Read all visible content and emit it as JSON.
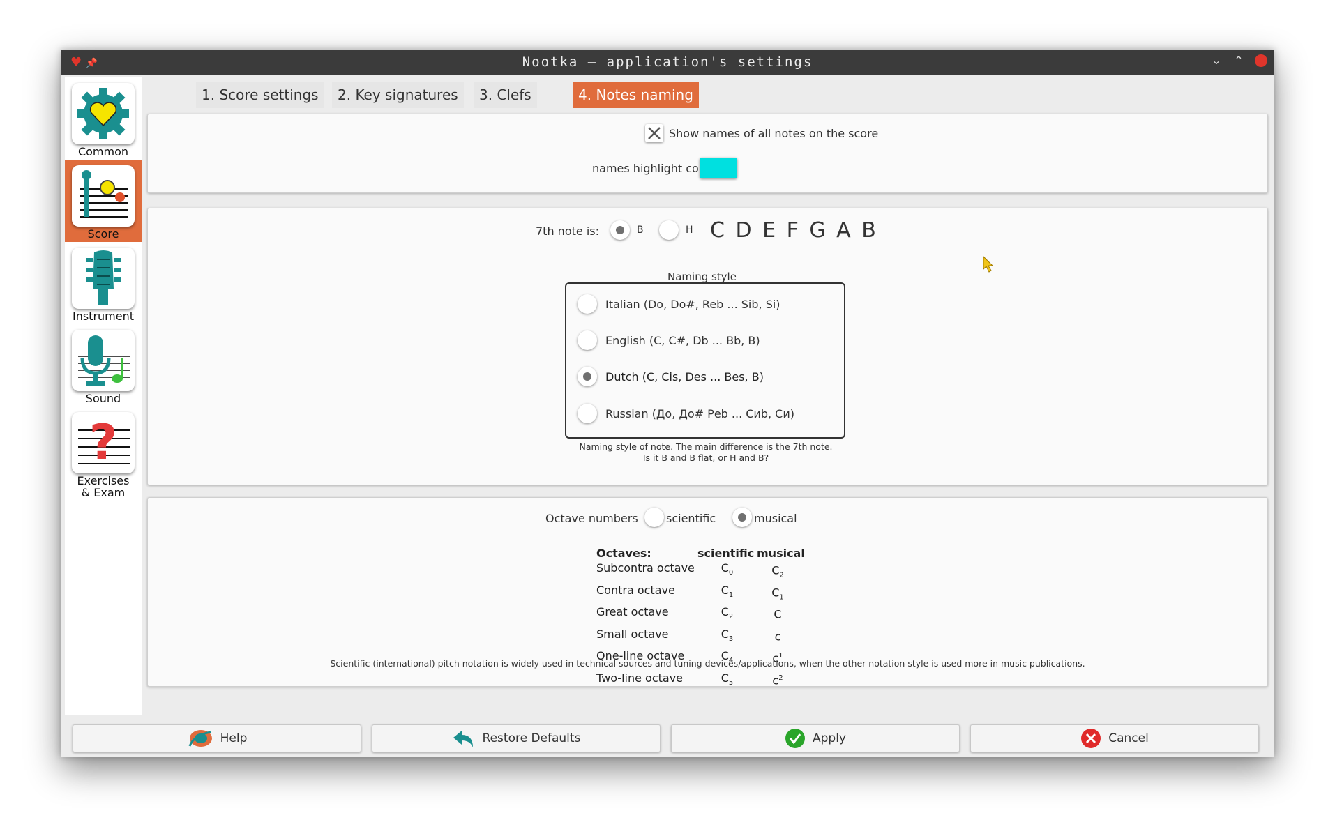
{
  "window": {
    "title": "Nootka – application's settings"
  },
  "sidebar": {
    "items": [
      {
        "label": "Common"
      },
      {
        "label": "Score"
      },
      {
        "label": "Instrument"
      },
      {
        "label": "Sound"
      },
      {
        "label": "Exercises & Exam"
      }
    ]
  },
  "tabs": [
    {
      "label": "1. Score settings"
    },
    {
      "label": "2. Key signatures"
    },
    {
      "label": "3. Clefs"
    },
    {
      "label": "4. Notes naming"
    }
  ],
  "names_panel": {
    "show_names_label": "Show names of all notes on the score",
    "highlight_color_label": "names highlight color",
    "highlight_color": "#00e0e0"
  },
  "naming_panel": {
    "seventh_note_label": "7th note is:",
    "option_b": "B",
    "option_h": "H",
    "scale_preview": "C D E F G A B",
    "naming_style_title": "Naming style",
    "styles": [
      {
        "label": "Italian (Do, Do#, Reb ... Sib, Si)"
      },
      {
        "label": "English (C, C#, Db ... Bb, B)"
      },
      {
        "label": "Dutch (C, Cis, Des ... Bes, B)"
      },
      {
        "label": "Russian (До, До# Реb ... Сиb, Си)"
      }
    ],
    "selected_style": "Dutch (C, Cis, Des ... Bes, B)",
    "description_line1": "Naming style of note. The main difference is the 7th note.",
    "description_line2": "Is it B and B flat, or H and B?"
  },
  "octave_panel": {
    "label": "Octave numbers",
    "option_scientific": "scientific",
    "option_musical": "musical",
    "table_headers": [
      "Octaves:",
      "scientific",
      "musical"
    ],
    "rows": [
      {
        "name": "Subcontra octave",
        "sci": "C",
        "sci_sub": "0",
        "mus": "C",
        "mus_sub": "2",
        "mus_sup": ""
      },
      {
        "name": "Contra octave",
        "sci": "C",
        "sci_sub": "1",
        "mus": "C",
        "mus_sub": "1",
        "mus_sup": ""
      },
      {
        "name": "Great octave",
        "sci": "C",
        "sci_sub": "2",
        "mus": "C",
        "mus_sub": "",
        "mus_sup": ""
      },
      {
        "name": "Small octave",
        "sci": "C",
        "sci_sub": "3",
        "mus": "c",
        "mus_sub": "",
        "mus_sup": ""
      },
      {
        "name": "One-line octave",
        "sci": "C",
        "sci_sub": "4",
        "mus": "c",
        "mus_sub": "",
        "mus_sup": "1"
      },
      {
        "name": "Two-line octave",
        "sci": "C",
        "sci_sub": "5",
        "mus": "c",
        "mus_sub": "",
        "mus_sup": "2"
      }
    ],
    "note": "Scientific (international) pitch notation is widely used in technical sources and tuning devices/applications, when the other notation style is used more in music publications."
  },
  "buttons": {
    "help": "Help",
    "restore": "Restore Defaults",
    "apply": "Apply",
    "cancel": "Cancel"
  }
}
